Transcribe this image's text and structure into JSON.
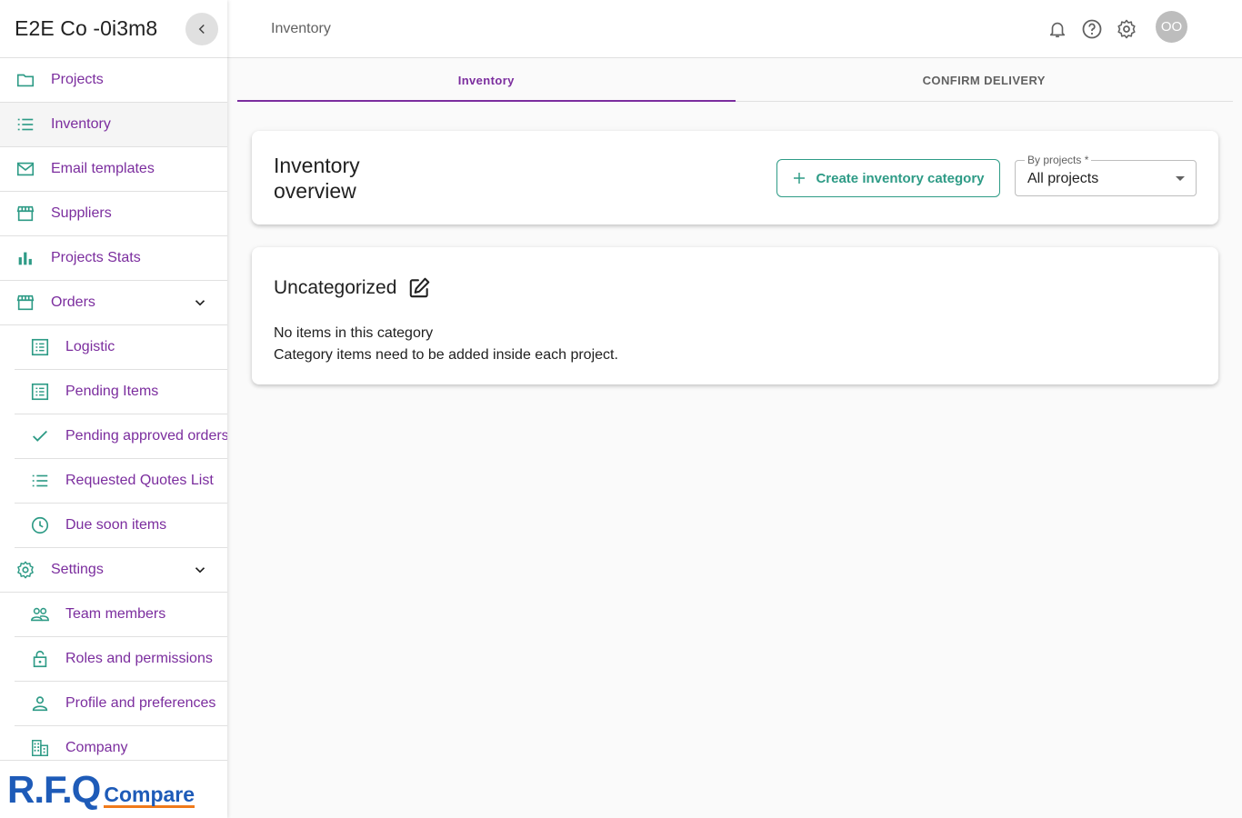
{
  "sidebar": {
    "company": "E2E Co -0i3m8",
    "items": [
      {
        "label": "Projects",
        "icon": "folder-icon"
      },
      {
        "label": "Inventory",
        "icon": "list-icon"
      },
      {
        "label": "Email templates",
        "icon": "mail-icon"
      },
      {
        "label": "Suppliers",
        "icon": "store-icon"
      },
      {
        "label": "Projects Stats",
        "icon": "bar-chart-icon"
      },
      {
        "label": "Orders",
        "icon": "store-icon"
      },
      {
        "label": "Logistic",
        "icon": "list-alt-icon"
      },
      {
        "label": "Pending Items",
        "icon": "list-alt-icon"
      },
      {
        "label": "Pending approved orders",
        "icon": "check-icon"
      },
      {
        "label": "Requested Quotes List",
        "icon": "list-icon"
      },
      {
        "label": "Due soon items",
        "icon": "clock-icon"
      },
      {
        "label": "Settings",
        "icon": "gear-icon"
      },
      {
        "label": "Team members",
        "icon": "people-icon"
      },
      {
        "label": "Roles and permissions",
        "icon": "lock-icon"
      },
      {
        "label": "Profile and preferences",
        "icon": "person-icon"
      },
      {
        "label": "Company",
        "icon": "building-icon"
      }
    ],
    "logo": {
      "part1": "R.F.Q",
      "part2": "Compare"
    }
  },
  "topbar": {
    "breadcrumb": "Inventory",
    "avatar_initials": "OO"
  },
  "tabs": [
    {
      "label": "Inventory",
      "active": true
    },
    {
      "label": "CONFIRM DELIVERY",
      "active": false
    }
  ],
  "overview": {
    "title": "Inventory overview",
    "create_button": "Create inventory category",
    "filter_label": "By projects *",
    "filter_value": "All projects"
  },
  "category": {
    "name": "Uncategorized",
    "empty_line1": "No items in this category",
    "empty_line2": "Category items need to be added inside each project."
  },
  "colors": {
    "accent_purple": "#7b2d9e",
    "accent_teal": "#2e9b86",
    "logo_blue": "#1e5bb8",
    "logo_orange": "#f07a1a"
  }
}
